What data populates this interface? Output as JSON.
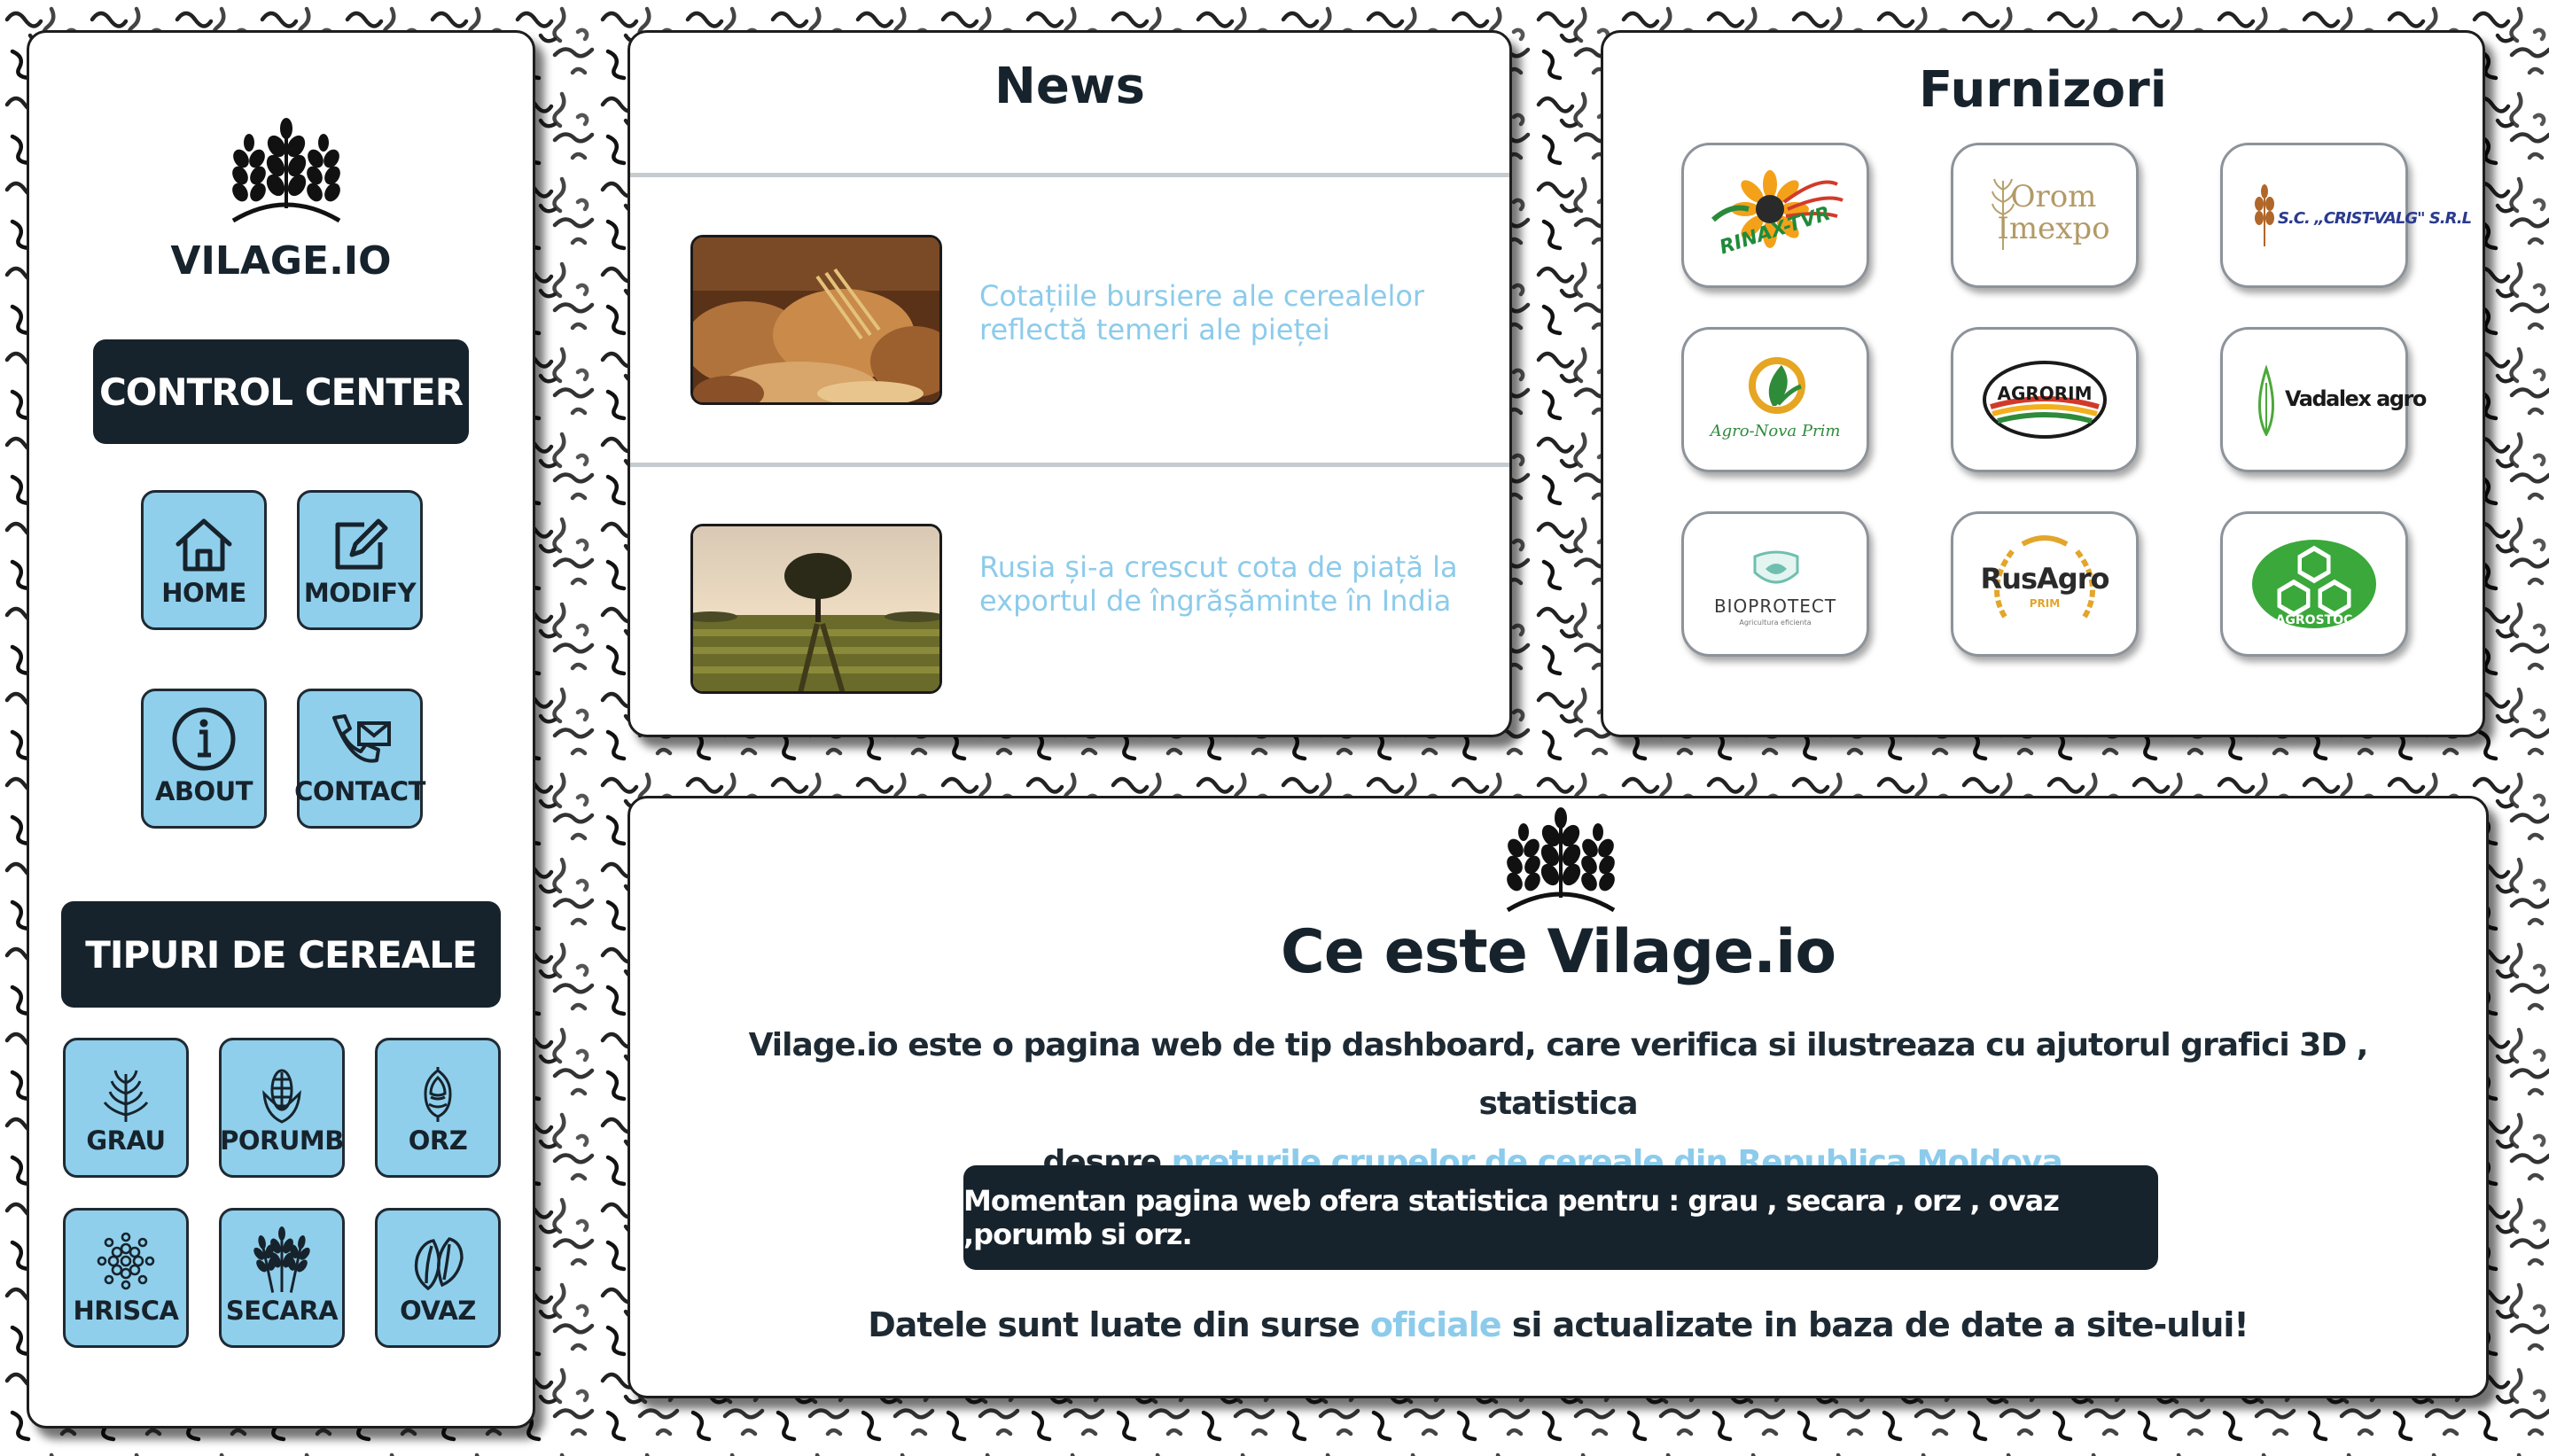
{
  "sidebar": {
    "brand": "VILAGE.IO",
    "control_center": "CONTROL CENTER",
    "nav": [
      {
        "label": "HOME",
        "icon": "home-icon"
      },
      {
        "label": "MODIFY",
        "icon": "edit-icon"
      },
      {
        "label": "ABOUT",
        "icon": "info-icon"
      },
      {
        "label": "CONTACT",
        "icon": "phone-mail-icon"
      }
    ],
    "cereals_title": "TIPURI DE CEREALE",
    "cereals": [
      {
        "label": "GRAU",
        "icon": "wheat-icon"
      },
      {
        "label": "PORUMB",
        "icon": "corn-icon"
      },
      {
        "label": "ORZ",
        "icon": "barley-icon"
      },
      {
        "label": "HRISCA",
        "icon": "buckwheat-icon"
      },
      {
        "label": "SECARA",
        "icon": "rye-icon"
      },
      {
        "label": "OVAZ",
        "icon": "oat-icon"
      }
    ]
  },
  "news": {
    "title": "News",
    "items": [
      {
        "text": "Cotațiile bursiere ale cerealelor reflectă temeri ale pieței"
      },
      {
        "text": "Rusia și-a crescut cota de piață la exportul de îngrășăminte în India"
      }
    ]
  },
  "suppliers": {
    "title": "Furnizori",
    "logos": [
      {
        "name": "RINAX-TVR"
      },
      {
        "name": "Orom",
        "name2": "Imexpo"
      },
      {
        "name": "S.C. „CRIST-VALG\" S.R.L"
      },
      {
        "name": "Agro-Nova Prim"
      },
      {
        "name": "AGRORIM"
      },
      {
        "name": "Vadalex agro"
      },
      {
        "name": "BIOPROTECT",
        "sub": "Agricultura eficienta"
      },
      {
        "name": "RusAgro",
        "sub": "PRIM"
      },
      {
        "name": "AGROSTOC"
      }
    ]
  },
  "about": {
    "title": "Ce este Vilage.io",
    "desc_part1": "Vilage.io este o pagina web de tip dashboard, care verifica si ilustreaza cu ajutorul grafici 3D , statistica",
    "desc_part2": "despre ",
    "desc_link": "preturile crupelor de cereale din Republica Moldova.",
    "banner": "Momentan pagina web ofera statistica pentru : grau , secara , orz , ovaz ,porumb si orz.",
    "footer_part1": "Datele sunt luate din surse ",
    "footer_link": "oficiale",
    "footer_part2": " si actualizate in baza de date a site-ului!"
  },
  "colors": {
    "accent": "#8ccbeb",
    "dark": "#17232c",
    "tile": "#8fcfec"
  }
}
